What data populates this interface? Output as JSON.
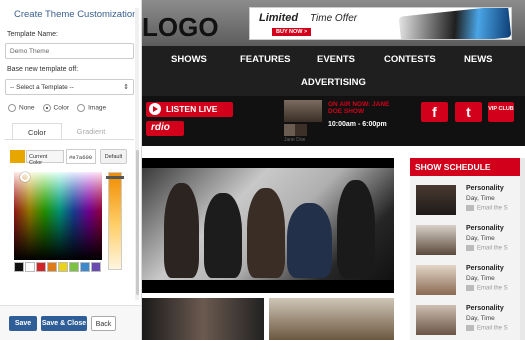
{
  "panel": {
    "title": "Create Theme Customization",
    "template_name_label": "Template Name:",
    "template_name_value": "Demo Theme",
    "base_label": "Base new template off:",
    "base_select": "-- Select a Template --",
    "radio_none": "None",
    "radio_color": "Color",
    "radio_image": "Image",
    "radio_selected": "Color",
    "tab_color": "Color",
    "tab_gradient": "Gradient",
    "current_color_label": "Current Color",
    "hex_value": "#e7a600",
    "default_label": "Default",
    "palette": [
      "#111111",
      "#ffffff",
      "#d2232a",
      "#e07b1a",
      "#e8d21a",
      "#7cc242",
      "#3b8ad0",
      "#6a4bb0"
    ],
    "save_label": "Save",
    "save_close_label": "Save & Close",
    "back_label": "Back"
  },
  "site": {
    "logo": "LOGO",
    "ad_limited": "Limited",
    "ad_rest": "Time Offer",
    "ad_button": "BUY NOW >",
    "nav": [
      "SHOWS",
      "FEATURES",
      "EVENTS",
      "CONTESTS",
      "NEWS",
      "ADVERTISING"
    ],
    "listen_live": "LISTEN LIVE",
    "rdio": "rdio",
    "on_air": "ON AIR NOW: JANE DOE SHOW",
    "show_time": "10:00am - 6:00pm",
    "jane_doe": "Jane Doe",
    "vip": "VIP CLUB",
    "schedule_title": "SHOW SCHEDULE",
    "schedule": [
      {
        "name": "Personality",
        "time": "Day, Time",
        "email": "Email the S"
      },
      {
        "name": "Personality",
        "time": "Day, Time",
        "email": "Email the S"
      },
      {
        "name": "Personality",
        "time": "Day, Time",
        "email": "Email the S"
      },
      {
        "name": "Personality",
        "time": "Day, Time",
        "email": "Email the S"
      }
    ],
    "brand_red": "#d2001a"
  }
}
